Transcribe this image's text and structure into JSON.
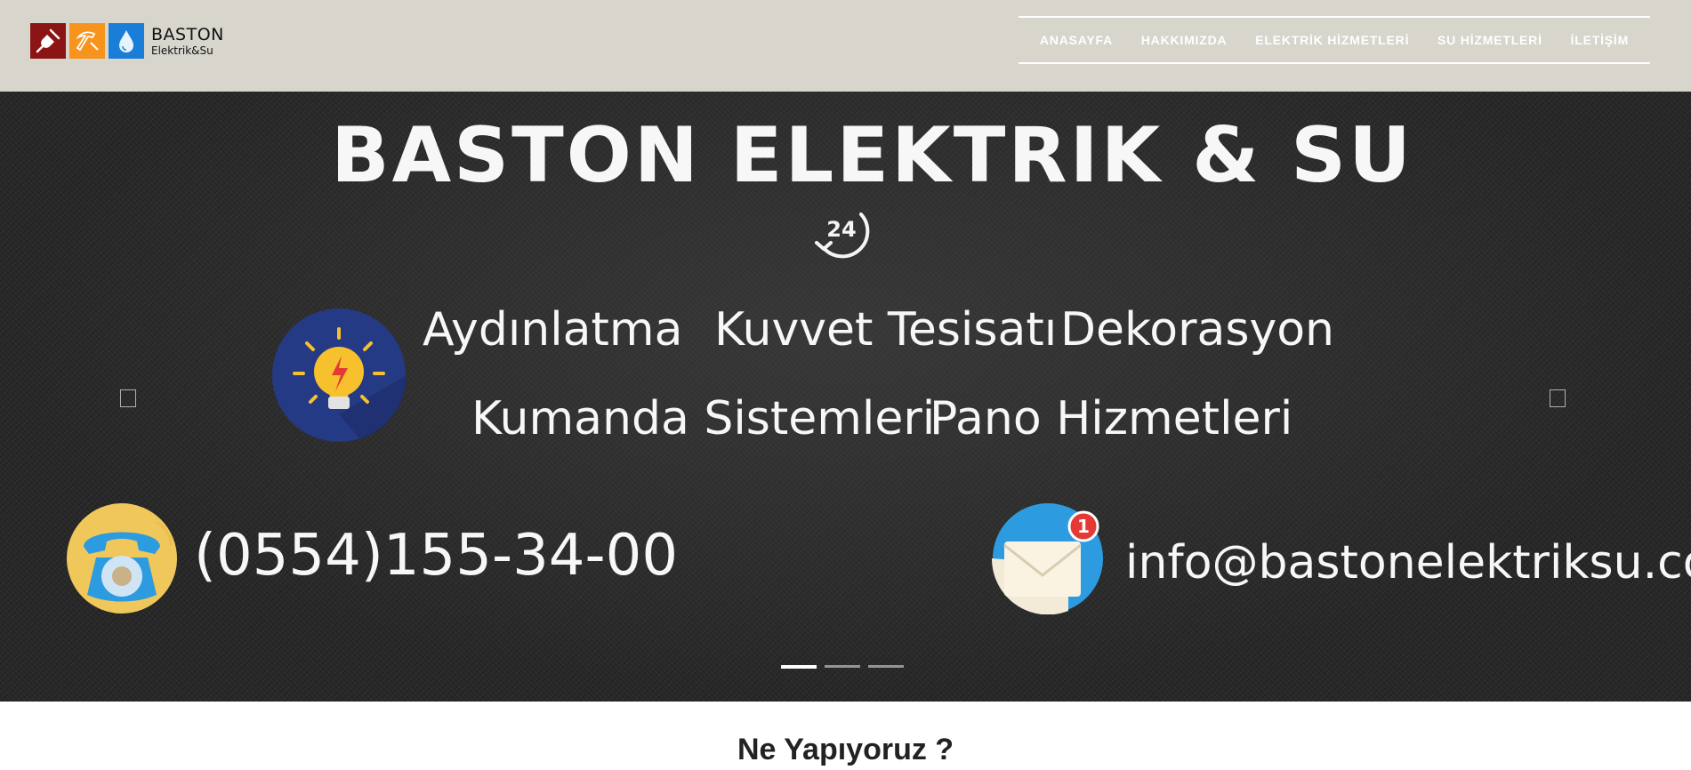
{
  "header": {
    "logo": {
      "brand": "BASTON",
      "sub": "Elektrik&Su",
      "tiles": [
        "plug-icon",
        "hammer-icon",
        "water-drop-icon"
      ],
      "tile_colors": [
        "#8b1414",
        "#f7941d",
        "#1a7ed8"
      ]
    },
    "nav": [
      {
        "label": "ANASAYFA"
      },
      {
        "label": "HAKKIMIZDA"
      },
      {
        "label": "ELEKTRİK HİZMETLERİ"
      },
      {
        "label": "SU HİZMETLERİ"
      },
      {
        "label": "İLETİŞİM"
      }
    ]
  },
  "slider": {
    "title": "BASTON ELEKTRIK & SU",
    "badge": "24",
    "services_row1": [
      "Aydınlatma",
      "Kuvvet Tesisatı",
      "Dekorasyon"
    ],
    "services_row2": [
      "Kumanda Sistemleri",
      "Pano Hizmetleri"
    ],
    "phone": "(0554)155-34-00",
    "email": "info@bastonelektriksu.com",
    "mail_badge": "1",
    "slides_count": 3,
    "active_slide": 1
  },
  "section": {
    "title": "Ne Yapıyoruz ?"
  },
  "colors": {
    "header_bg": "#d8d5cd",
    "hero_bg": "#252525",
    "bulb_circle": "#253a85",
    "bulb": "#f6c12c",
    "phone_circle": "#f0c75a",
    "mail_circle": "#2d9be0",
    "notification": "#e53935"
  }
}
